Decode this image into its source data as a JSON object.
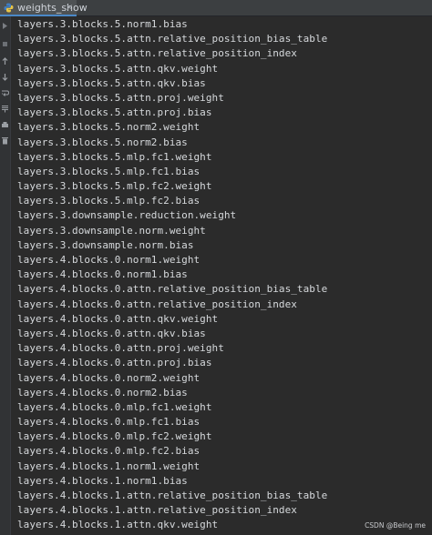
{
  "tab": {
    "title": "weights_show",
    "close_glyph": "×",
    "icon": "python-file-icon"
  },
  "gutter": {
    "icons": [
      "rerun-icon",
      "stop-icon",
      "up-arrow-icon",
      "down-arrow-icon",
      "wrap-icon",
      "scroll-end-icon",
      "print-icon",
      "delete-icon"
    ]
  },
  "output": {
    "lines": [
      "layers.3.blocks.5.norm1.bias",
      "layers.3.blocks.5.attn.relative_position_bias_table",
      "layers.3.blocks.5.attn.relative_position_index",
      "layers.3.blocks.5.attn.qkv.weight",
      "layers.3.blocks.5.attn.qkv.bias",
      "layers.3.blocks.5.attn.proj.weight",
      "layers.3.blocks.5.attn.proj.bias",
      "layers.3.blocks.5.norm2.weight",
      "layers.3.blocks.5.norm2.bias",
      "layers.3.blocks.5.mlp.fc1.weight",
      "layers.3.blocks.5.mlp.fc1.bias",
      "layers.3.blocks.5.mlp.fc2.weight",
      "layers.3.blocks.5.mlp.fc2.bias",
      "layers.3.downsample.reduction.weight",
      "layers.3.downsample.norm.weight",
      "layers.3.downsample.norm.bias",
      "layers.4.blocks.0.norm1.weight",
      "layers.4.blocks.0.norm1.bias",
      "layers.4.blocks.0.attn.relative_position_bias_table",
      "layers.4.blocks.0.attn.relative_position_index",
      "layers.4.blocks.0.attn.qkv.weight",
      "layers.4.blocks.0.attn.qkv.bias",
      "layers.4.blocks.0.attn.proj.weight",
      "layers.4.blocks.0.attn.proj.bias",
      "layers.4.blocks.0.norm2.weight",
      "layers.4.blocks.0.norm2.bias",
      "layers.4.blocks.0.mlp.fc1.weight",
      "layers.4.blocks.0.mlp.fc1.bias",
      "layers.4.blocks.0.mlp.fc2.weight",
      "layers.4.blocks.0.mlp.fc2.bias",
      "layers.4.blocks.1.norm1.weight",
      "layers.4.blocks.1.norm1.bias",
      "layers.4.blocks.1.attn.relative_position_bias_table",
      "layers.4.blocks.1.attn.relative_position_index",
      "layers.4.blocks.1.attn.qkv.weight"
    ]
  },
  "watermark": "CSDN @Being me",
  "colors": {
    "background": "#2b2b2b",
    "text": "#d6d9dc",
    "tab_active_underline": "#4a88c7"
  }
}
